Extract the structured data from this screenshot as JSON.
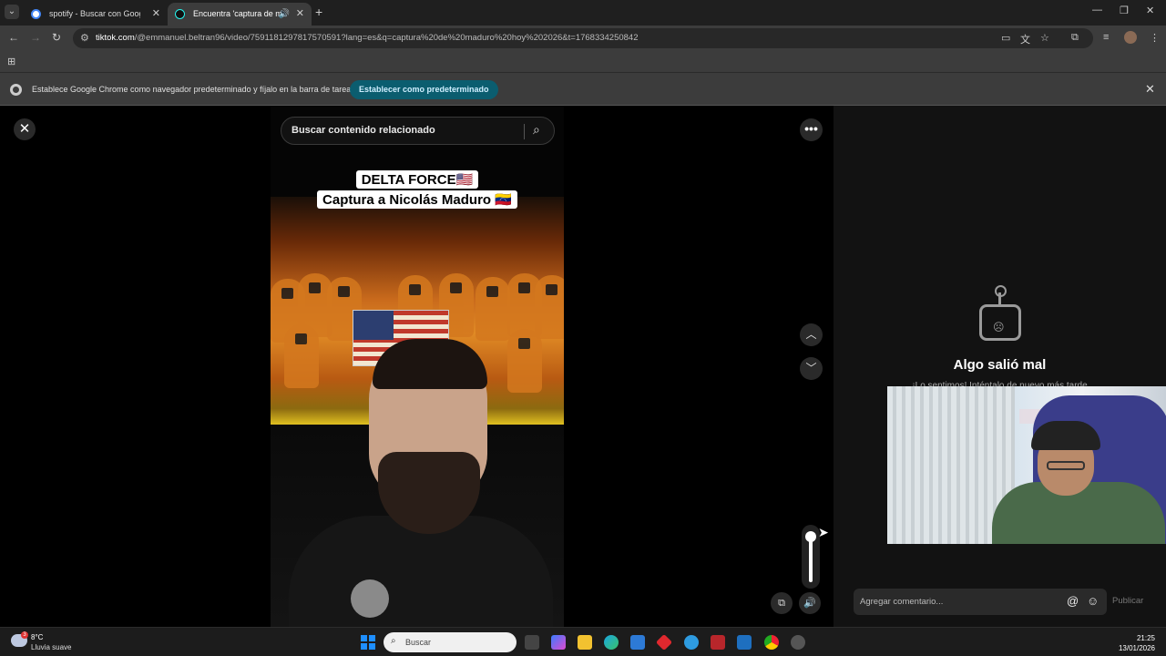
{
  "browser": {
    "tabs": [
      {
        "title": "spotify - Buscar con Google",
        "active": false
      },
      {
        "title": "Encuentra 'captura de mad",
        "active": true
      }
    ],
    "url_host": "tiktok.com",
    "url_rest": "/@emmanuel.beltran96/video/7591181297817570591?lang=es&q=captura%20de%20maduro%20hoy%202026&t=1768334250842",
    "infobar_message": "Establece Google Chrome como navegador predeterminado y fíjalo en la barra de tareas",
    "infobar_button": "Establecer como predeterminado"
  },
  "tiktok": {
    "search_placeholder": "Buscar contenido relacionado",
    "caption_line1": "DELTA FORCE🇺🇸",
    "caption_line2": "Captura a Nicolás Maduro 🇻🇪",
    "error_title": "Algo salió mal",
    "error_subtitle": "¡Lo sentimos! Inténtalo de nuevo más tarde",
    "comment_placeholder": "Agregar comentario...",
    "publish_label": "Publicar",
    "volume_level": 1.0
  },
  "taskbar": {
    "weather_temp": "8°C",
    "weather_desc": "Lluvia suave",
    "weather_badge": "3",
    "search_label": "Buscar",
    "time": "21:25",
    "date": "13/01/2026"
  },
  "colors": {
    "infobar_button_bg": "#0b5d6f",
    "page_bg": "#000000",
    "panel_bg": "#121212"
  }
}
